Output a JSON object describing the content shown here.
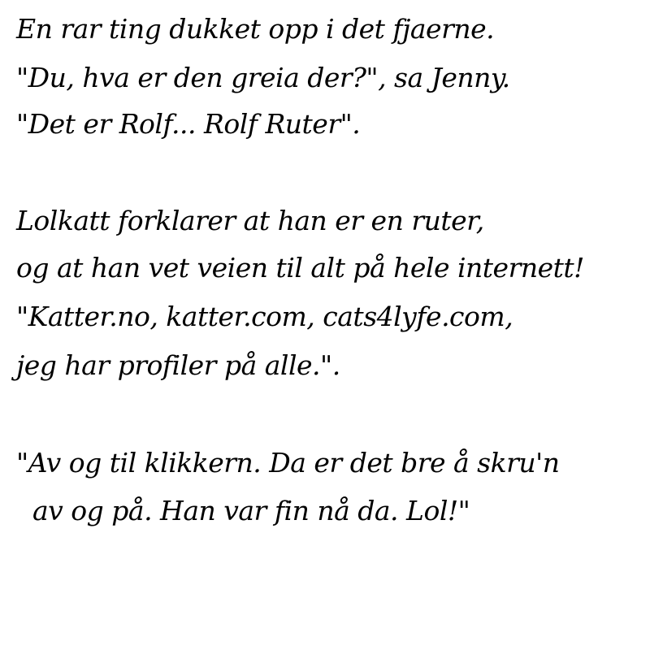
{
  "paragraphs": [
    {
      "lines": [
        "En rar ting dukket opp i det fjaerne.",
        "\"Du, hva er den greia der?\", sa Jenny.",
        "\"Det er Rolf... Rolf Ruter\"."
      ]
    },
    {
      "lines": [
        "Lolkatt forklarer at han er en ruter,",
        "og at han vet veien til alt på hele internett!",
        "\"Katter.no, katter.com, cats4lyfe.com,",
        "jeg har profiler på alle.\"."
      ]
    },
    {
      "lines": [
        "\"Av og til klikkern. Da er det bre å skru'n",
        "  av og på. Han var fin nå da. Lol!\""
      ]
    }
  ],
  "colors": {
    "text": "#000000",
    "background": "#ffffff"
  }
}
